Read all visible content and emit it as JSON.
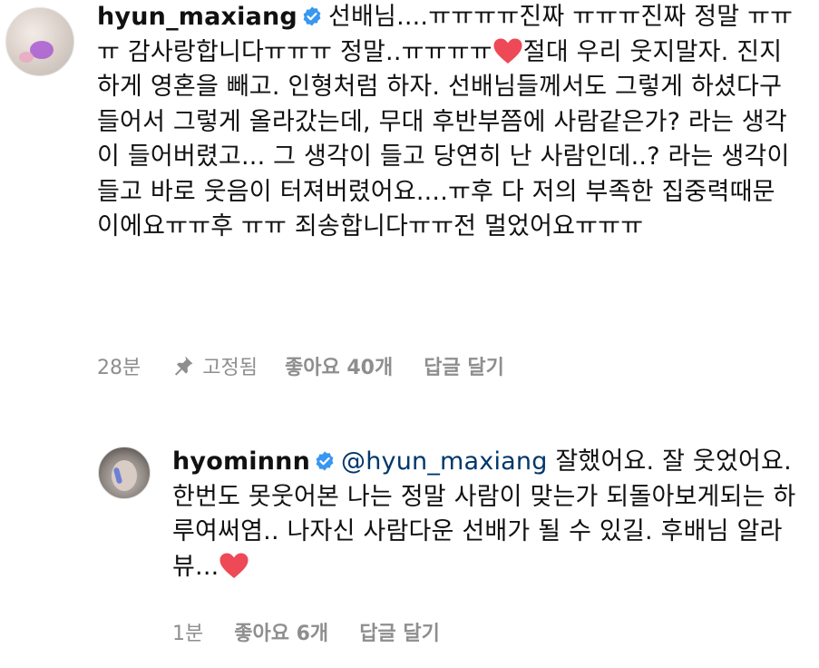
{
  "comments": [
    {
      "username": "hyun_maxiang",
      "text_before_heart": "선배님....ㅠㅠㅠㅠ진짜 ㅠㅠㅠ진짜 정말 ㅠㅠㅠ 감사랑합니다ㅠㅠㅠ 정말..ㅠㅠㅠㅠ",
      "text_after_heart": "절대 우리 웃지말자. 진지하게 영혼을 빼고. 인형처럼 하자. 선배님들께서도 그렇게 하셨다구 들어서 그렇게 올라갔는데, 무대 후반부쯤에 사람같은가? 라는 생각이 들어버렸고... 그 생각이 들고 당연히 난 사람인데..? 라는 생각이 들고 바로 웃음이 터져버렸어요....ㅠ후 다 저의 부족한 집중력때문이에요ㅠㅠ후 ㅠㅠ 죄송합니다ㅠㅠ전 멀었어요ㅠㅠㅠ",
      "time": "28분",
      "pinned_label": "고정됨",
      "likes_label": "좋아요 40개",
      "reply_label": "답글 달기"
    },
    {
      "username": "hyominnn",
      "mention": "@hyun_maxiang",
      "text": "잘했어요. 잘 웃었어요. 한번도 못웃어본 나는 정말 사람이 맞는가 되돌아보게되는 하루여써염.. 나자신 사람다운 선배가 될 수 있길. 후배님 알라뷰...",
      "time": "1분",
      "likes_label": "좋아요 6개",
      "reply_label": "답글 달기"
    }
  ],
  "colors": {
    "verified": "#3897f0",
    "heart": "#ed4956",
    "meta": "#8e8e8e",
    "mention": "#00376b"
  },
  "icons": {
    "verified": "verified-badge-icon",
    "pin": "pin-icon",
    "heart": "heart-emoji-icon"
  }
}
